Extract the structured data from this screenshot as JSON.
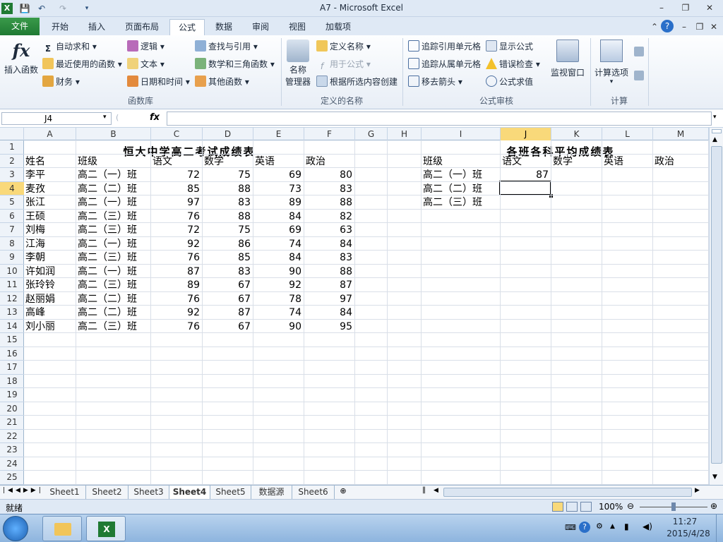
{
  "window": {
    "title": "A7  -  Microsoft Excel"
  },
  "tabs": [
    "文件",
    "开始",
    "插入",
    "页面布局",
    "公式",
    "数据",
    "审阅",
    "视图",
    "加载项"
  ],
  "ribbon": {
    "insert_function": "插入函数",
    "autosum": "自动求和",
    "recent": "最近使用的函数",
    "financial": "财务",
    "logical": "逻辑",
    "text": "文本",
    "datetime": "日期和时间",
    "lookup": "查找与引用",
    "math": "数学和三角函数",
    "other": "其他函数",
    "group_library": "函数库",
    "name_manager_1": "名称",
    "name_manager_2": "管理器",
    "define_name": "定义名称",
    "use_in_formula": "用于公式",
    "create_from_sel": "根据所选内容创建",
    "group_names": "定义的名称",
    "trace_precedents": "追踪引用单元格",
    "trace_dependents": "追踪从属单元格",
    "remove_arrows": "移去箭头",
    "show_formulas": "显示公式",
    "error_checking": "错误检查",
    "evaluate": "公式求值",
    "watch_window": "监视窗口",
    "group_audit": "公式审核",
    "calc_options": "计算选项",
    "group_calc": "计算"
  },
  "formula_bar": {
    "name_box": "J4",
    "fx": "fx",
    "formula": ""
  },
  "columns": [
    "A",
    "B",
    "C",
    "D",
    "E",
    "F",
    "G",
    "H",
    "I",
    "J",
    "K",
    "L",
    "M"
  ],
  "rows": [
    "1",
    "2",
    "3",
    "4",
    "5",
    "6",
    "7",
    "8",
    "9",
    "10",
    "11",
    "12",
    "13",
    "14",
    "15",
    "16",
    "17",
    "18",
    "19",
    "20",
    "21",
    "22",
    "23",
    "24",
    "25"
  ],
  "sheet": {
    "title_left": "恒大中学高二考试成绩表",
    "title_right": "各班各科平均成绩表",
    "headers_left": [
      "姓名",
      "班级",
      "语文",
      "数学",
      "英语",
      "政治"
    ],
    "students": [
      [
        "李平",
        "高二（一）班",
        "72",
        "75",
        "69",
        "80"
      ],
      [
        "麦孜",
        "高二（二）班",
        "85",
        "88",
        "73",
        "83"
      ],
      [
        "张江",
        "高二（一）班",
        "97",
        "83",
        "89",
        "88"
      ],
      [
        "王硕",
        "高二（三）班",
        "76",
        "88",
        "84",
        "82"
      ],
      [
        "刘梅",
        "高二（三）班",
        "72",
        "75",
        "69",
        "63"
      ],
      [
        "江海",
        "高二（一）班",
        "92",
        "86",
        "74",
        "84"
      ],
      [
        "李朝",
        "高二（三）班",
        "76",
        "85",
        "84",
        "83"
      ],
      [
        "许如润",
        "高二（一）班",
        "87",
        "83",
        "90",
        "88"
      ],
      [
        "张玲铃",
        "高二（三）班",
        "89",
        "67",
        "92",
        "87"
      ],
      [
        "赵丽娟",
        "高二（二）班",
        "76",
        "67",
        "78",
        "97"
      ],
      [
        "高峰",
        "高二（二）班",
        "92",
        "87",
        "74",
        "84"
      ],
      [
        "刘小丽",
        "高二（三）班",
        "76",
        "67",
        "90",
        "95"
      ]
    ],
    "headers_right": [
      "班级",
      "语文",
      "数学",
      "英语",
      "政治"
    ],
    "classes": [
      "高二（一）班",
      "高二（二）班",
      "高二（三）班"
    ],
    "avg_j3": "87"
  },
  "sheet_tabs": [
    "Sheet1",
    "Sheet2",
    "Sheet3",
    "Sheet4",
    "Sheet5",
    "数据源",
    "Sheet6"
  ],
  "active_sheet": "Sheet4",
  "status": {
    "ready": "就绪",
    "zoom": "100%"
  },
  "taskbar": {
    "time": "11:27",
    "date": "2015/4/28"
  }
}
